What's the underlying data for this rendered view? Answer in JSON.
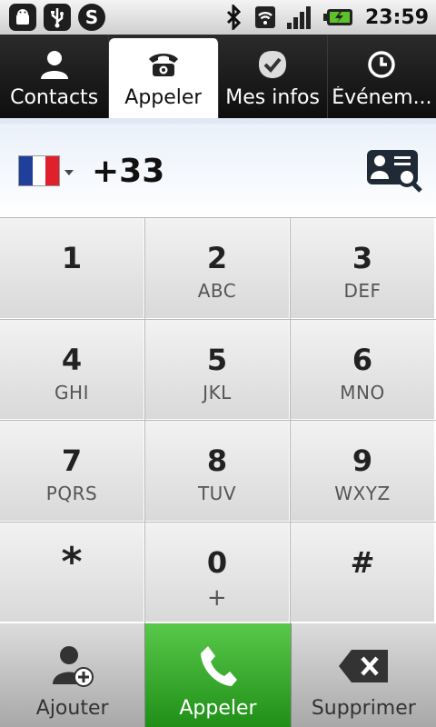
{
  "status_bar": {
    "left_icons": [
      "android-debug-icon",
      "usb-icon",
      "skype-icon"
    ],
    "right_icons": [
      "bluetooth-icon",
      "wifi-icon",
      "signal-icon",
      "battery-icon"
    ],
    "time": "23:59"
  },
  "tabs": [
    {
      "label": "Contacts",
      "icon": "person-icon",
      "active": false
    },
    {
      "label": "Appeler",
      "icon": "telephone-icon",
      "active": true
    },
    {
      "label": "Mes infos",
      "icon": "check-badge-icon",
      "active": false
    },
    {
      "label": "Événem...",
      "icon": "clock-icon",
      "active": false
    }
  ],
  "dial": {
    "country_flag": "France",
    "number": "+33"
  },
  "keypad": [
    {
      "digit": "1",
      "letters": ""
    },
    {
      "digit": "2",
      "letters": "ABC"
    },
    {
      "digit": "3",
      "letters": "DEF"
    },
    {
      "digit": "4",
      "letters": "GHI"
    },
    {
      "digit": "5",
      "letters": "JKL"
    },
    {
      "digit": "6",
      "letters": "MNO"
    },
    {
      "digit": "7",
      "letters": "PQRS"
    },
    {
      "digit": "8",
      "letters": "TUV"
    },
    {
      "digit": "9",
      "letters": "WXYZ"
    },
    {
      "digit": "*",
      "letters": ""
    },
    {
      "digit": "0",
      "letters": "+"
    },
    {
      "digit": "#",
      "letters": ""
    }
  ],
  "actions": [
    {
      "label": "Ajouter",
      "icon": "add-contact-icon"
    },
    {
      "label": "Appeler",
      "icon": "phone-handset-icon"
    },
    {
      "label": "Supprimer",
      "icon": "backspace-icon"
    }
  ],
  "colors": {
    "call_green": "#2fa62a",
    "flag_blue": "#1f3f9a",
    "flag_white": "#ffffff",
    "flag_red": "#e0202a"
  }
}
